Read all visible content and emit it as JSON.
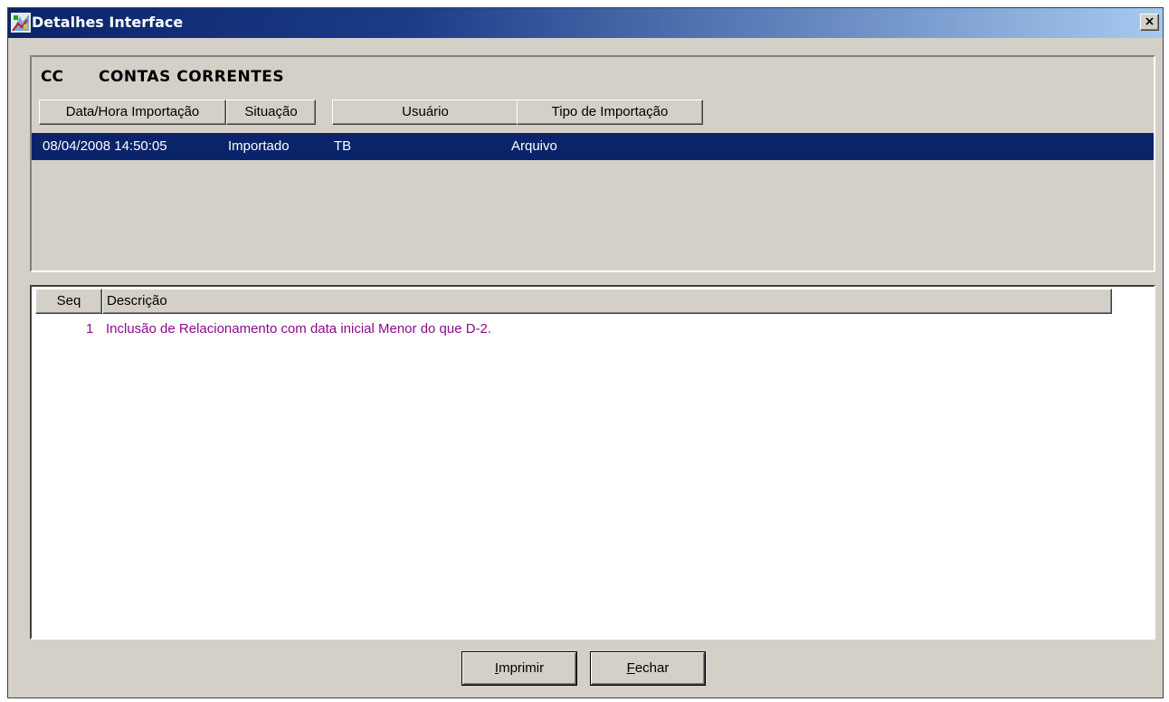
{
  "window": {
    "title": "Detalhes Interface",
    "close_label": "×"
  },
  "header": {
    "code": "CC",
    "name": "CONTAS CORRENTES"
  },
  "import_table": {
    "columns": [
      "Data/Hora Importação",
      "Situação",
      "Usuário",
      "Tipo de Importação"
    ],
    "rows": [
      [
        "08/04/2008 14:50:05",
        "Importado",
        "TB",
        "Arquivo"
      ]
    ],
    "selected_row": 0
  },
  "details_table": {
    "columns": [
      "Seq",
      "Descrição"
    ],
    "rows": [
      [
        "1",
        "Inclusão de Relacionamento com data inicial Menor do que D-2."
      ]
    ]
  },
  "buttons": {
    "print_mnemonic": "I",
    "print_rest": "mprimir",
    "close_mnemonic": "F",
    "close_rest": "echar"
  },
  "colors": {
    "title_gradient_start": "#0a246a",
    "title_gradient_end": "#a6caf0",
    "selection": "#0a246a",
    "detail_text": "#8b0a8b",
    "face": "#d4d0c8"
  },
  "icons": {
    "app": "app-icon",
    "close": "close-icon"
  }
}
